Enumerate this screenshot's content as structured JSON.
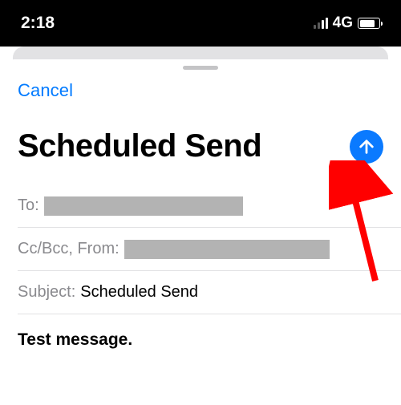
{
  "status": {
    "time": "2:18",
    "network_label": "4G"
  },
  "compose": {
    "cancel_label": "Cancel",
    "title": "Scheduled Send",
    "fields": {
      "to_label": "To:",
      "ccbcc_label": "Cc/Bcc, From:",
      "subject_label": "Subject:",
      "subject_value": "Scheduled Send"
    },
    "body_text": "Test message."
  },
  "icons": {
    "send": "arrow-up-circle"
  },
  "colors": {
    "accent": "#007aff",
    "send_bg": "#0a7aff",
    "annotation": "#ff0000"
  }
}
